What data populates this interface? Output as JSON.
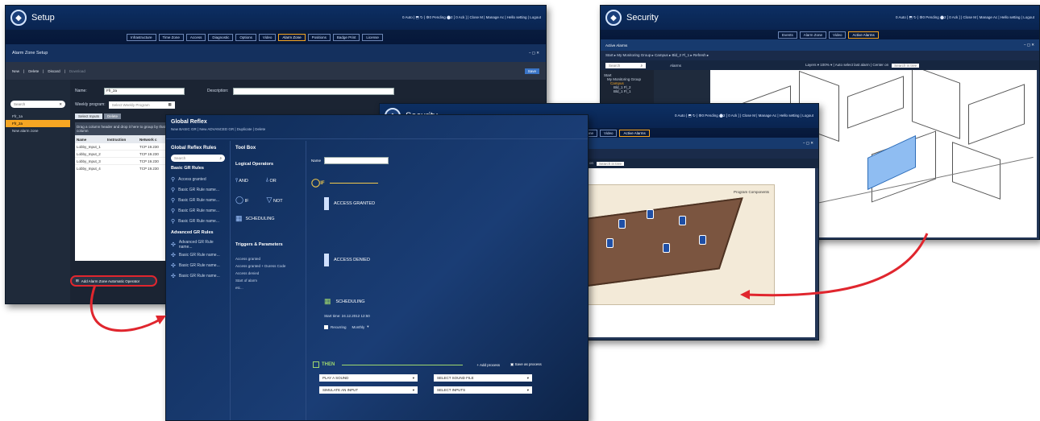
{
  "setup": {
    "title": "Setup",
    "status_text": "0 Auto | ⬒ ↻ | ⚙0 Pending ⬤2 [ 0 Ack ] | Close M | Manage Ac | Hello setting | Logout",
    "nav": [
      "Infrastructure",
      "Time Zone",
      "Access",
      "Diagnostic",
      "Options",
      "Video",
      "Alarm Zone",
      "Positions",
      "Badge Print",
      "License"
    ],
    "section_title": "Alarm Zone Setup",
    "toolbar": {
      "new": "New",
      "delete": "Delete",
      "discard": "Discard",
      "download": "Download",
      "save": "Save"
    },
    "search_placeholder": "Search",
    "list": [
      "Ffr_1a",
      "Ffr_2a",
      "New alarm zone"
    ],
    "name_label": "Name:",
    "name_value": "Ffr_2a",
    "desc_label": "Description:",
    "weekly_label": "Weekly program:",
    "weekly_placeholder": "Select Weekly Program",
    "tabs": [
      "Select Inputs",
      "Delete"
    ],
    "drag_hint": "Drag a column header and drop it here to group by that column",
    "cols": [
      "Name",
      "Instruction",
      "Network c"
    ],
    "rows": [
      [
        "Lobby_Input_1",
        "",
        "TCP 19.230"
      ],
      [
        "Lobby_Input_2",
        "",
        "TCP 19.230"
      ],
      [
        "Lobby_Input_3",
        "",
        "TCP 19.230"
      ],
      [
        "Lobby_Input_4",
        "",
        "TCP 19.230"
      ]
    ],
    "add_operator": "Add Alarm Zone Automatic Operator"
  },
  "gr": {
    "title": "Global Reflex",
    "sub": "New BASIC GR | New ADVANCED GR | Duplicate | Delete",
    "rules_title": "Global Reflex Rules",
    "search_placeholder": "Search",
    "basic_title": "Basic GR Rules",
    "basic": [
      "Access granted",
      "Basic GR Rule name...",
      "Basic GR Rule name...",
      "Basic GR Rule name...",
      "Basic GR Rule name..."
    ],
    "adv_title": "Advanced GR Rules",
    "adv": [
      "Advanced GR Rule name...",
      "Basic GR Rule name...",
      "Basic GR Rule name...",
      "Basic GR Rule name..."
    ],
    "toolbox": "Tool Box",
    "logical": "Logical Operators",
    "and": "AND",
    "or": "OR",
    "if": "IF",
    "not": "NOT",
    "sched": "SCHEDULING",
    "trig_title": "Triggers & Parameters",
    "triggers": [
      "Access granted",
      "Access granted + Duress Code",
      "Access denied",
      "Start of alarm",
      "etc..."
    ],
    "name_label": "Name",
    "ag": "ACCESS GRANTED",
    "ad": "ACCESS DENIED",
    "sc": "SCHEDULING",
    "start_time": "Start time: 24.12.2012 12:50",
    "recurring": "Recurring",
    "monthly": "Monthly",
    "then": "THEN",
    "add_process": "Add process",
    "save_process": "Save as process",
    "d1": "PLAY A SOUND",
    "d2": "SELECT SOUND FILE",
    "d3": "SIMULATE AN INPUT",
    "d4": "SELECT INPUTS"
  },
  "sec1": {
    "title": "Security",
    "status_text": "0 Auto | ⬒ ↻ | ⚙0 Pending ⬤2 [ 0 Ack ] | Close M | Manage Ac | Hello setting | Logout",
    "nav": [
      "Events",
      "Alarm Zone",
      "Video",
      "Active Alarms"
    ],
    "section": "Active Alarms",
    "crumbs": "Start ▸ My Monitoring Group ▸ Campus ▸ Bld_2 Fl_1 ▸ Refresh ▸",
    "alarms_label": "Alarms",
    "search_placeholder": "Search",
    "tree": [
      "Start",
      "My Monitoring Group",
      "Campus",
      "Bld_1 Fl_2",
      "Bld_1 Fl_1"
    ],
    "tools": "Layers ▾ 100% ▾ | Auto select last alarm | Center on",
    "find": "Search in tree"
  },
  "sec2": {
    "title": "Security",
    "status_text": "0 Auto | ⬒ ↻ | ⚙0 Pending ⬤2 [ 0 Ack ] | Close M | Manage Ac | Hello setting | Logout",
    "nav": [
      "Events",
      "Alarm Zone",
      "Video",
      "Active Alarms"
    ],
    "section": "Active Alarms",
    "crumbs": "Start ▸ My Monitoring Group ▸ Campus ▸ Bld_2 Fl_1 ▸ Refresh ▸",
    "alarms_label": "Alarms",
    "search_placeholder": "Search",
    "tree": [
      "Start",
      "My Monitoring Group",
      "Campus",
      "Bld_2 Fl_1",
      "Bld_1 Fl_1"
    ],
    "tools": "Layers ▾ 100% ▾ | Auto select last alarm | Center on",
    "find": "Search in tree",
    "plan_title": "Floor Plan Attributes",
    "plan_right": "Program Components"
  },
  "colors": {
    "accent": "#f6a623",
    "navy": "#0b2c5e",
    "panel": "#1b2433",
    "arrow": "#e0262e"
  }
}
